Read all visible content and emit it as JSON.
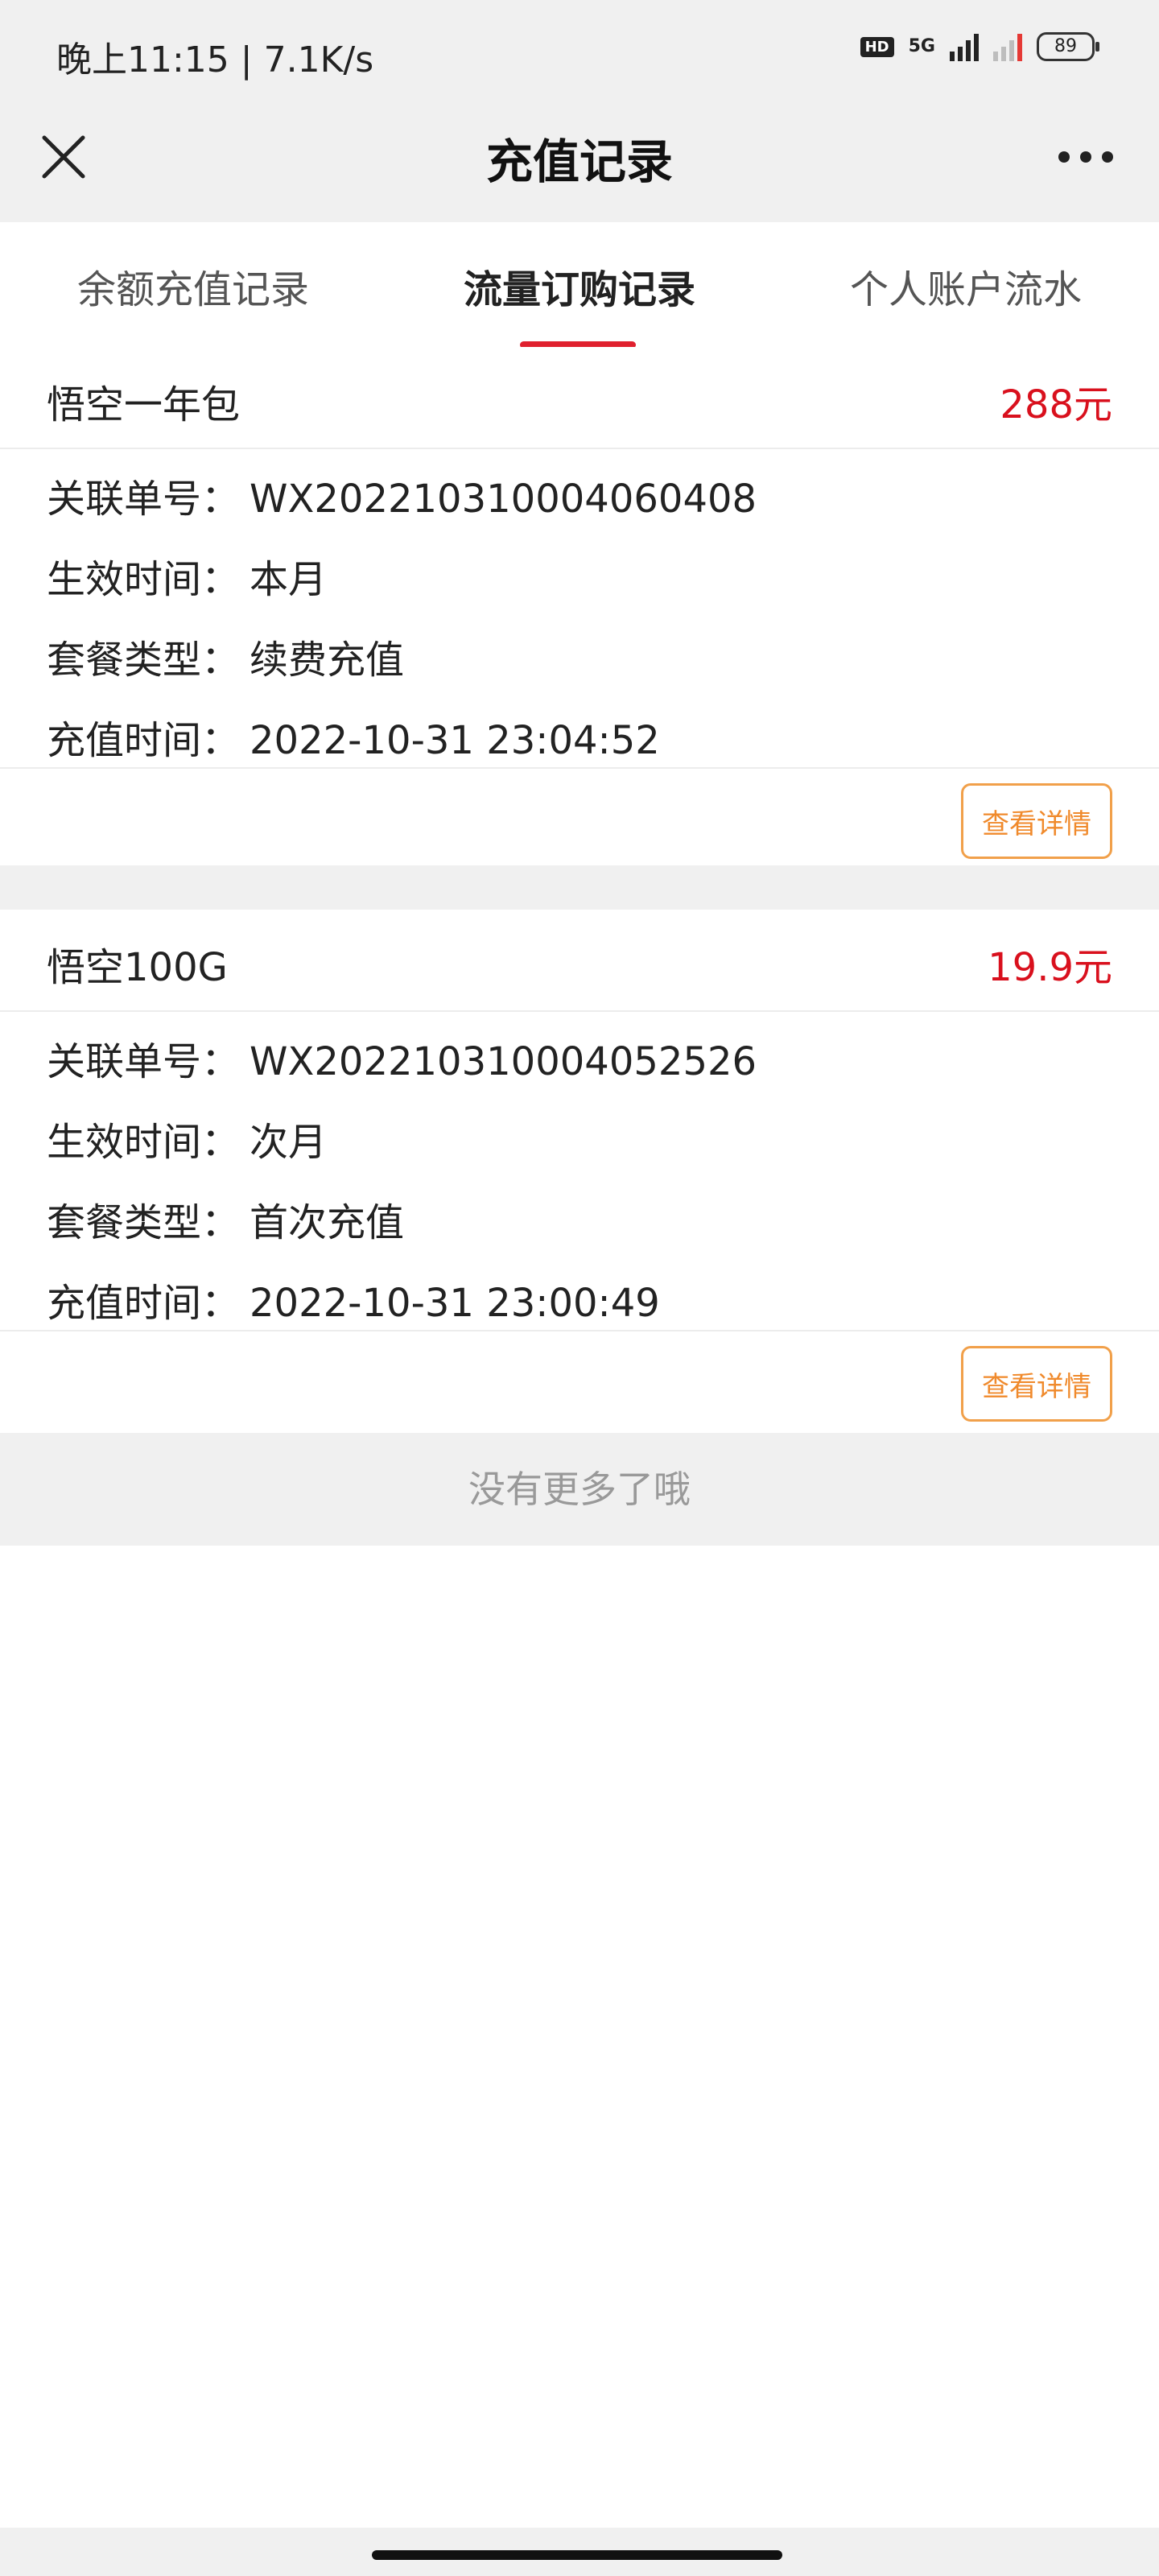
{
  "status_bar": {
    "time": "晚上11:15 | 7.1K/s",
    "hd": "HD",
    "network": "5G",
    "battery": "89"
  },
  "title_bar": {
    "title": "充值记录",
    "close_icon": "close-icon",
    "more_icon": "more-dots-icon"
  },
  "tabs": [
    {
      "label": "余额充值记录",
      "active": false
    },
    {
      "label": "流量订购记录",
      "active": true
    },
    {
      "label": "个人账户流水",
      "active": false
    }
  ],
  "field_labels": {
    "order_no": "关联单号：",
    "effective": "生效时间：",
    "package_type": "套餐类型：",
    "recharge_time": "充值时间："
  },
  "records": [
    {
      "name": "悟空一年包",
      "price": "288元",
      "order_no": "WX202210310004060408",
      "effective": "本月",
      "package_type": "续费充值",
      "recharge_time": "2022-10-31 23:04:52",
      "detail_label": "查看详情"
    },
    {
      "name": "悟空100G",
      "price": "19.9元",
      "order_no": "WX202210310004052526",
      "effective": "次月",
      "package_type": "首次充值",
      "recharge_time": "2022-10-31 23:00:49",
      "detail_label": "查看详情"
    }
  ],
  "no_more": "没有更多了哦",
  "colors": {
    "accent_red": "#e0202e",
    "price_red": "#d9101d",
    "detail_orange": "#f08a2c",
    "background_gray": "#f0f0f0"
  }
}
